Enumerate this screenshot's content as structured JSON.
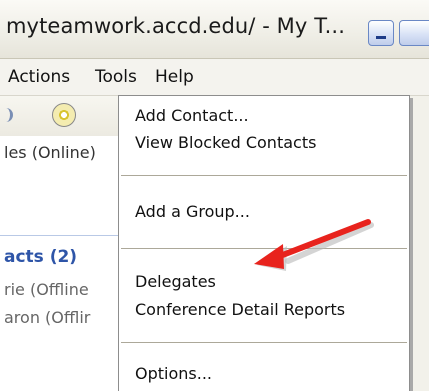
{
  "window": {
    "title": "myteamwork.accd.edu/ - My T..."
  },
  "menubar": {
    "items": [
      "Actions",
      "Tools",
      "Help"
    ]
  },
  "background": {
    "status_text": "les (Online)",
    "contacts_header": "acts (2)",
    "contact_1": "rie (Offline",
    "contact_2": "aron (Offlir"
  },
  "dropdown": {
    "add_contact": "Add Contact...",
    "view_blocked": "View Blocked Contacts",
    "add_group": "Add a Group...",
    "delegates": "Delegates",
    "conference_reports": "Conference Detail Reports",
    "options": "Options..."
  },
  "annotation": {
    "arrow_color": "#e8231d"
  },
  "colors": {
    "contacts_header": "#2e55a8",
    "menu_separator": "#aca899"
  }
}
